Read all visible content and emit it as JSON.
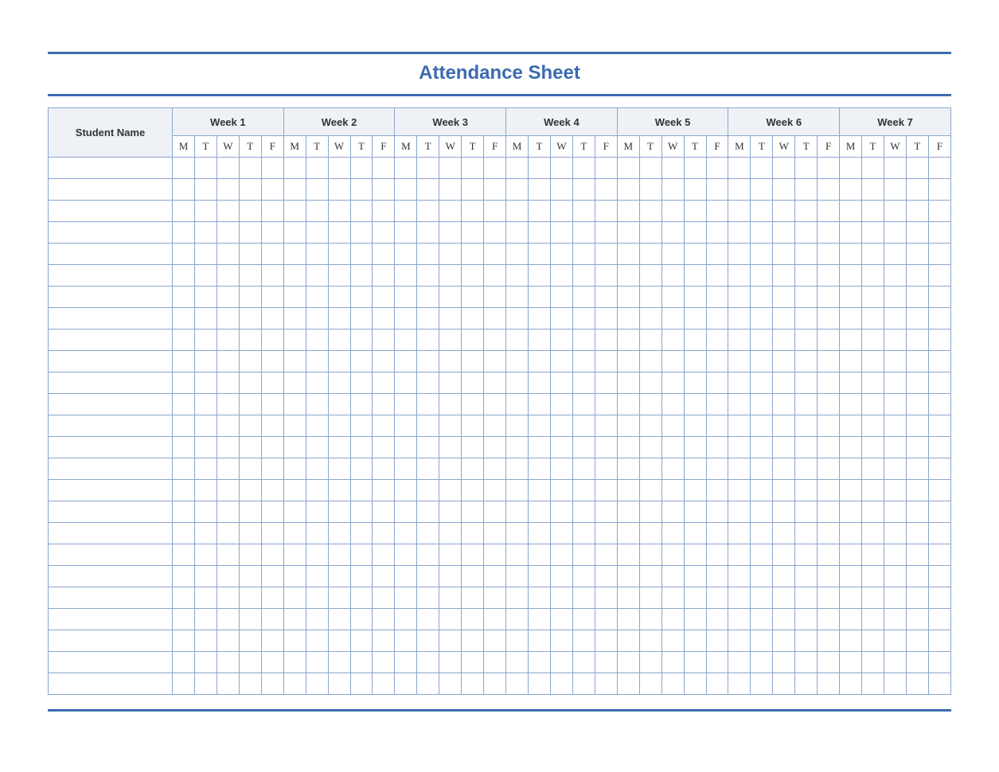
{
  "title": "Attendance Sheet",
  "columns": {
    "name_header": "Student Name",
    "weeks": [
      "Week 1",
      "Week 2",
      "Week 3",
      "Week 4",
      "Week 5",
      "Week 6",
      "Week 7"
    ],
    "days": [
      "M",
      "T",
      "W",
      "T",
      "F"
    ]
  },
  "rows": 25,
  "colors": {
    "accent": "#3e6ab0",
    "grid": "#8aa6cf",
    "header_fill": "#eef1f5"
  }
}
